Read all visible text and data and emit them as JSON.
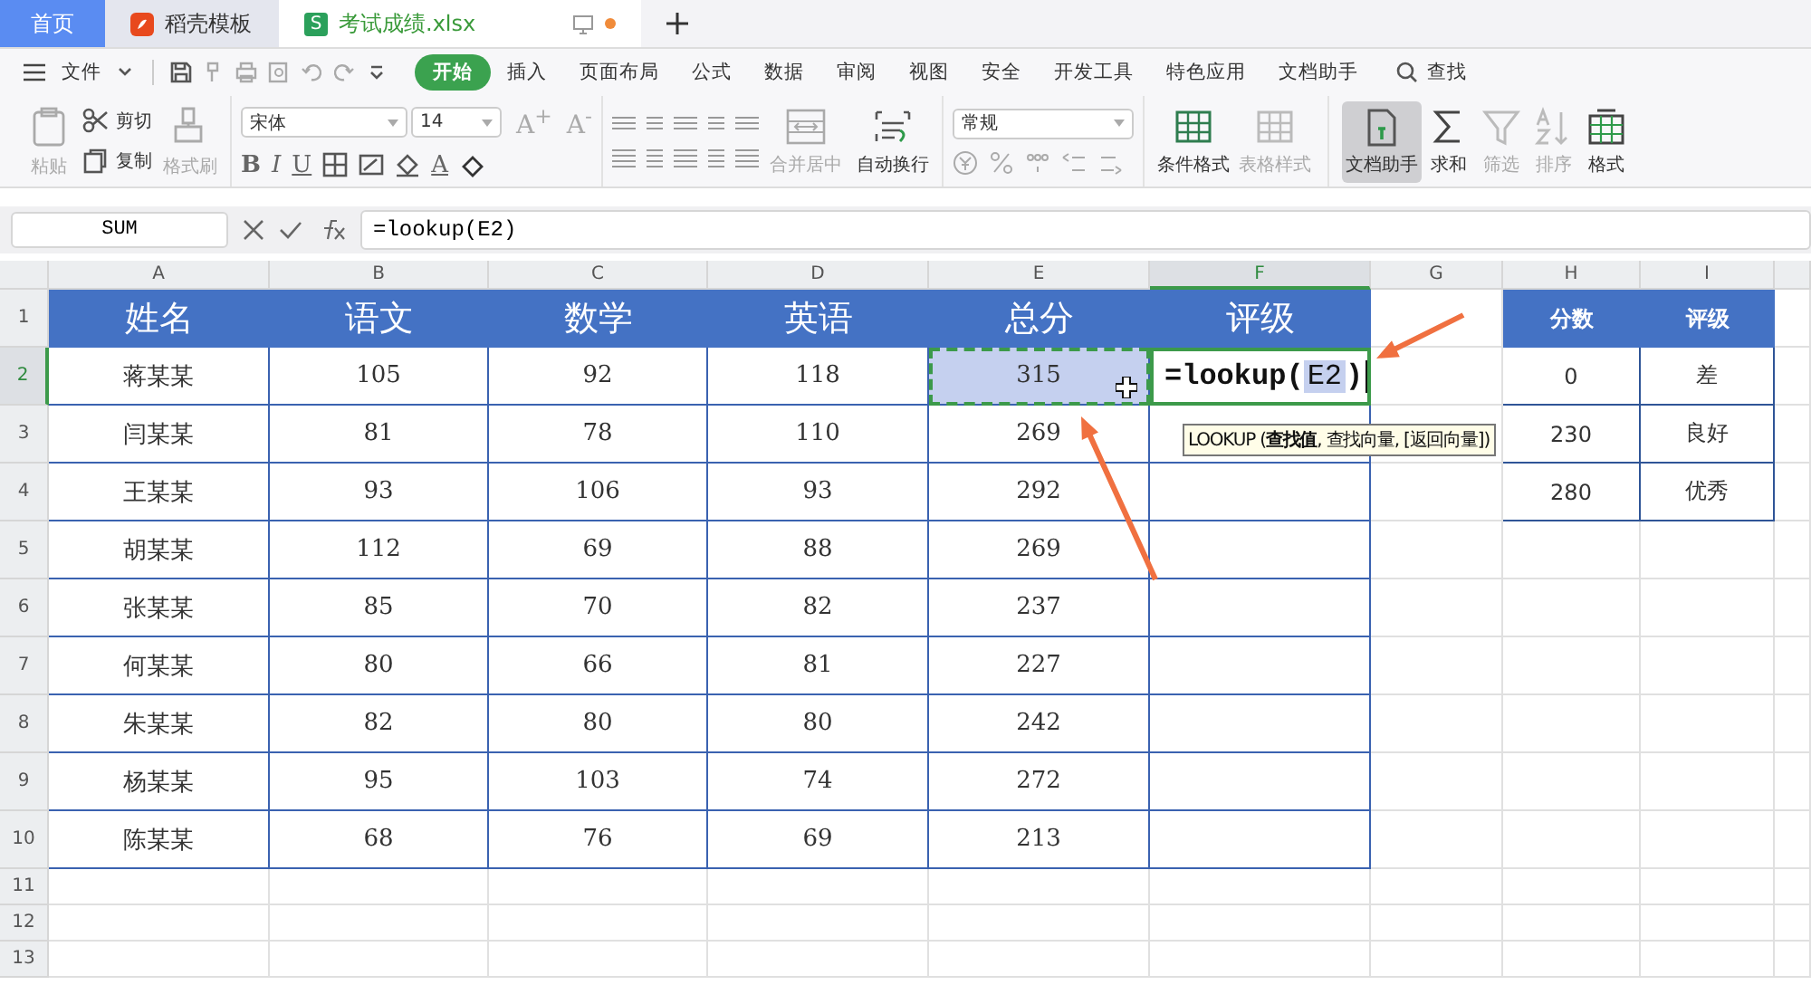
{
  "doc_tabs": [
    {
      "label": "首页",
      "kind": "home",
      "selected": false
    },
    {
      "label": "稻壳模板",
      "kind": "docer",
      "selected": false
    },
    {
      "label": "考试成绩.xlsx",
      "kind": "sheet",
      "badge": "S",
      "selected": true
    }
  ],
  "menu": {
    "file": "文件",
    "tabs": [
      {
        "label": "开始",
        "selected": true
      },
      {
        "label": "插入",
        "selected": false
      },
      {
        "label": "页面布局",
        "selected": false
      },
      {
        "label": "公式",
        "selected": false
      },
      {
        "label": "数据",
        "selected": false
      },
      {
        "label": "审阅",
        "selected": false
      },
      {
        "label": "视图",
        "selected": false
      },
      {
        "label": "安全",
        "selected": false
      },
      {
        "label": "开发工具",
        "selected": false
      },
      {
        "label": "特色应用",
        "selected": false
      },
      {
        "label": "文档助手",
        "selected": false
      }
    ],
    "search": "查找"
  },
  "ribbon": {
    "clipboard": [
      {
        "label": "粘贴",
        "kind": "paste",
        "disabled": true
      },
      {
        "label": "剪切",
        "kind": "cut",
        "disabled": false
      },
      {
        "label": "复制",
        "kind": "copy",
        "disabled": false
      },
      {
        "label": "格式刷",
        "kind": "painter",
        "disabled": true
      }
    ],
    "font_name": "宋体",
    "font_size": "14",
    "size_buttons": [
      "A$^{+}$",
      "A$^{-}$"
    ],
    "style_buttons": [
      "B",
      "I",
      "U"
    ],
    "font_color": "A",
    "merge": "合并居中",
    "wrap": "自动换行",
    "number_format": "常规",
    "tools": [
      {
        "label": "条件格式",
        "kind": "cond",
        "disabled": false,
        "pressed": false
      },
      {
        "label": "表格样式",
        "kind": "table",
        "disabled": true,
        "pressed": false
      },
      {
        "label": "文档助手",
        "kind": "assist",
        "disabled": false,
        "pressed": true
      },
      {
        "label": "求和",
        "kind": "sum",
        "disabled": false,
        "pressed": false
      },
      {
        "label": "筛选",
        "kind": "filter",
        "disabled": true,
        "pressed": false
      },
      {
        "label": "排序",
        "kind": "sort",
        "disabled": true,
        "pressed": false
      },
      {
        "label": "格式",
        "kind": "format",
        "disabled": false,
        "pressed": false
      }
    ]
  },
  "formula_bar": {
    "name_box": "SUM",
    "formula": "=lookup(E2)"
  },
  "sheet": {
    "columns": [
      {
        "label": "A",
        "selected": false
      },
      {
        "label": "B",
        "selected": false
      },
      {
        "label": "C",
        "selected": false
      },
      {
        "label": "D",
        "selected": false
      },
      {
        "label": "E",
        "selected": false
      },
      {
        "label": "F",
        "selected": true
      },
      {
        "label": "G",
        "selected": false
      },
      {
        "label": "H",
        "selected": false
      },
      {
        "label": "I",
        "selected": false
      }
    ],
    "row_numbers": [
      {
        "label": "1",
        "selected": false
      },
      {
        "label": "2",
        "selected": true
      },
      {
        "label": "3",
        "selected": false
      },
      {
        "label": "4",
        "selected": false
      },
      {
        "label": "5",
        "selected": false
      },
      {
        "label": "6",
        "selected": false
      },
      {
        "label": "7",
        "selected": false
      },
      {
        "label": "8",
        "selected": false
      },
      {
        "label": "9",
        "selected": false
      },
      {
        "label": "10",
        "selected": false
      },
      {
        "label": "11",
        "selected": false
      },
      {
        "label": "12",
        "selected": false
      },
      {
        "label": "13",
        "selected": false
      }
    ],
    "score_table": {
      "headers": [
        "姓名",
        "语文",
        "数学",
        "英语",
        "总分",
        "评级"
      ],
      "rows": [
        {
          "cells": [
            "蒋某某",
            "105",
            "92",
            "118",
            "315"
          ],
          "referenced": true,
          "editing": {
            "prefix": "=lookup(",
            "ref": "E2",
            "suffix": ")"
          }
        },
        {
          "cells": [
            "闫某某",
            "81",
            "78",
            "110",
            "269"
          ],
          "referenced": false
        },
        {
          "cells": [
            "王某某",
            "93",
            "106",
            "93",
            "292"
          ],
          "referenced": false
        },
        {
          "cells": [
            "胡某某",
            "112",
            "69",
            "88",
            "269"
          ],
          "referenced": false
        },
        {
          "cells": [
            "张某某",
            "85",
            "70",
            "82",
            "237"
          ],
          "referenced": false
        },
        {
          "cells": [
            "何某某",
            "80",
            "66",
            "81",
            "227"
          ],
          "referenced": false
        },
        {
          "cells": [
            "朱某某",
            "82",
            "80",
            "80",
            "242"
          ],
          "referenced": false
        },
        {
          "cells": [
            "杨某某",
            "95",
            "103",
            "74",
            "272"
          ],
          "referenced": false
        },
        {
          "cells": [
            "陈某某",
            "68",
            "76",
            "69",
            "213"
          ],
          "referenced": false
        }
      ]
    },
    "grade_table": {
      "headers": [
        "分数",
        "评级"
      ],
      "rows": [
        [
          "0",
          "差"
        ],
        [
          "230",
          "良好"
        ],
        [
          "280",
          "优秀"
        ]
      ]
    },
    "tooltip": "LOOKUP (**查找值**, 查找向量, [返回向量])"
  }
}
